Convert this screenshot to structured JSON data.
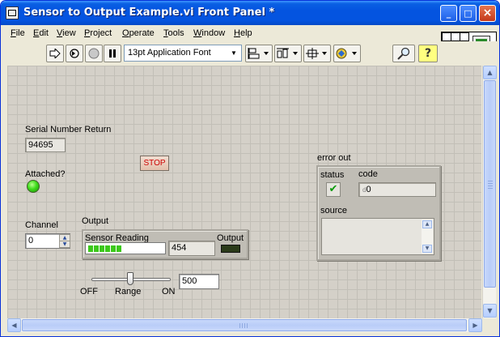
{
  "window": {
    "title": "Sensor to Output Example.vi Front Panel *",
    "controls": {
      "minimize": "_",
      "maximize": "□",
      "close": "×"
    }
  },
  "menu": {
    "items": [
      {
        "label": "File",
        "accel": "F",
        "rest": "ile"
      },
      {
        "label": "Edit",
        "accel": "E",
        "rest": "dit"
      },
      {
        "label": "View",
        "accel": "V",
        "rest": "iew"
      },
      {
        "label": "Project",
        "accel": "P",
        "rest": "roject"
      },
      {
        "label": "Operate",
        "accel": "O",
        "rest": "perate"
      },
      {
        "label": "Tools",
        "accel": "T",
        "rest": "ools"
      },
      {
        "label": "Window",
        "accel": "W",
        "rest": "indow"
      },
      {
        "label": "Help",
        "accel": "H",
        "rest": "elp"
      }
    ]
  },
  "toolbar": {
    "font_selector": "13pt Application Font",
    "icons": [
      "run-arrow-icon",
      "run-continuously-icon",
      "abort-icon",
      "pause-icon",
      "align-objects-icon",
      "distribute-objects-icon",
      "resize-objects-icon",
      "reorder-icon",
      "search-icon",
      "context-help-icon"
    ],
    "help_glyph": "?",
    "connector_pane_number": "1"
  },
  "front_panel": {
    "serial_number": {
      "label": "Serial Number Return",
      "value": "94695"
    },
    "attached": {
      "label": "Attached?",
      "state": "on",
      "color": "#3fdc1b"
    },
    "stop_button": {
      "label": "STOP"
    },
    "channel": {
      "label": "Channel",
      "value": "0"
    },
    "output_cluster": {
      "label": "Output",
      "sensor_reading_label": "Sensor Reading",
      "sensor_reading_value": "454",
      "output_label": "Output",
      "progress_fraction": 0.45
    },
    "range_slider": {
      "label": "Range",
      "min_label": "OFF",
      "max_label": "ON",
      "value": "500"
    },
    "error_out": {
      "label": "error out",
      "status_label": "status",
      "code_label": "code",
      "code_value": "0",
      "code_prefix": "d",
      "source_label": "source",
      "status_glyph": "✔"
    }
  },
  "colors": {
    "title_bar": "#0454e0",
    "panel_grid": "#d4d0c8",
    "led_on": "#3fdc1b",
    "stop_text": "#cc0000"
  }
}
